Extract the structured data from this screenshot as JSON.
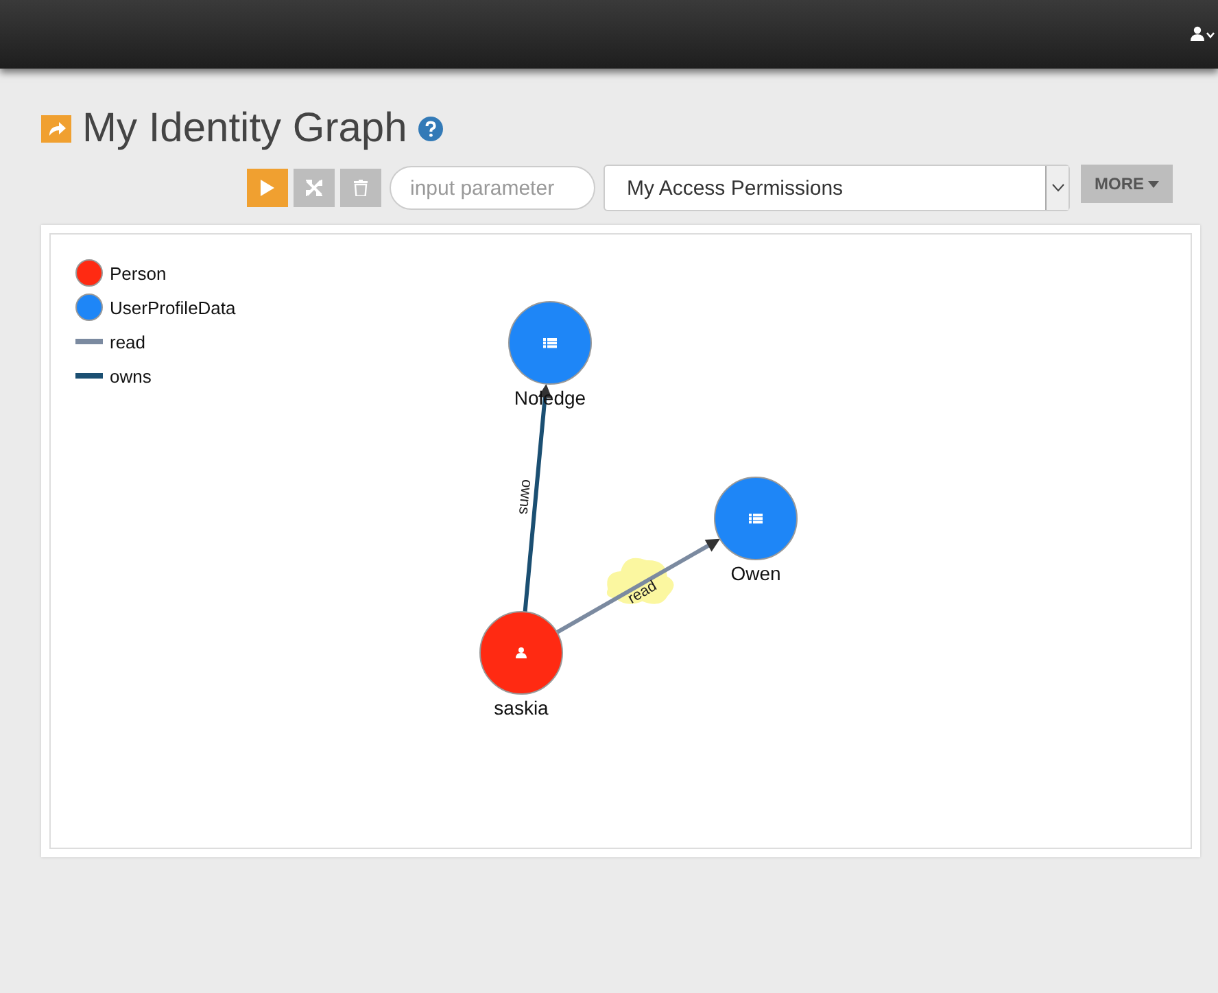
{
  "page": {
    "title": "My Identity Graph"
  },
  "toolbar": {
    "parameter_field": {
      "placeholder": "input parameter"
    },
    "query_select": {
      "value": "My Access Permissions"
    },
    "more_button": {
      "label": "MORE"
    }
  },
  "legend": [
    {
      "kind": "node",
      "label": "Person",
      "color": "#ff2a12"
    },
    {
      "kind": "node",
      "label": "UserProfileData",
      "color": "#1e86f7"
    },
    {
      "kind": "edge",
      "label": "read",
      "color": "#7b8aa0"
    },
    {
      "kind": "edge",
      "label": "owns",
      "color": "#1b4f72"
    }
  ],
  "graph": {
    "nodes": [
      {
        "label": "Noledge",
        "kind": "data",
        "color": "#1e86f7"
      },
      {
        "label": "Owen",
        "kind": "data",
        "color": "#1e86f7"
      },
      {
        "label": "saskia",
        "kind": "person",
        "color": "#ff2a12"
      }
    ],
    "edges": [
      {
        "label": "owns",
        "color": "#1b4f72",
        "highlighted": false
      },
      {
        "label": "read",
        "color": "#7b8aa0",
        "highlighted": true
      }
    ]
  }
}
